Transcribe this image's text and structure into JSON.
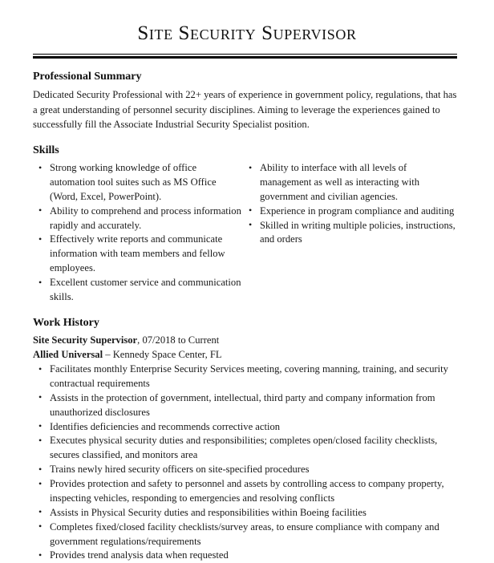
{
  "document": {
    "title": "Site Security Supervisor"
  },
  "sections": {
    "summary": {
      "heading": "Professional Summary",
      "text": "Dedicated Security Professional with 22+ years of experience in government policy, regulations, that has a great understanding of personnel security disciplines. Aiming to leverage the experiences gained to successfully fill the Associate Industrial Security Specialist position."
    },
    "skills": {
      "heading": "Skills",
      "left_column": [
        "Strong working knowledge of office automation tool suites such as MS Office (Word, Excel, PowerPoint).",
        "Ability to comprehend and process information rapidly and accurately.",
        "Effectively write reports and communicate information with team members and fellow employees.",
        "Excellent customer service and communication skills."
      ],
      "right_column": [
        "Ability to interface with all levels of management as well as interacting with government and civilian agencies.",
        "Experience in program compliance and auditing",
        "Skilled in writing multiple policies, instructions, and orders"
      ]
    },
    "work_history": {
      "heading": "Work History",
      "jobs": [
        {
          "job_title": "Site Security Supervisor",
          "dates": ", 07/2018 to Current",
          "company": "Allied Universal",
          "location": " – Kennedy Space Center, FL",
          "bullets": [
            "Facilitates monthly Enterprise Security Services meeting, covering manning, training, and security contractual requirements",
            "Assists in the protection of government, intellectual, third party and company information from unauthorized disclosures",
            "Identifies deficiencies and recommends corrective action",
            "Executes physical security duties and responsibilities; completes open/closed facility checklists, secures classified, and monitors area",
            "Trains newly hired security officers on site-specified procedures",
            "Provides protection and safety to personnel and assets by controlling access to company property, inspecting vehicles, responding to emergencies and resolving conflicts",
            "Assists in Physical Security duties and responsibilities within Boeing facilities",
            "Completes fixed/closed facility checklists/survey areas, to ensure compliance with company and government regulations/requirements",
            "Provides trend analysis data when requested"
          ]
        }
      ]
    }
  },
  "colors": {
    "text": "#1a1a1a",
    "rule": "#000000",
    "background": "#ffffff"
  }
}
